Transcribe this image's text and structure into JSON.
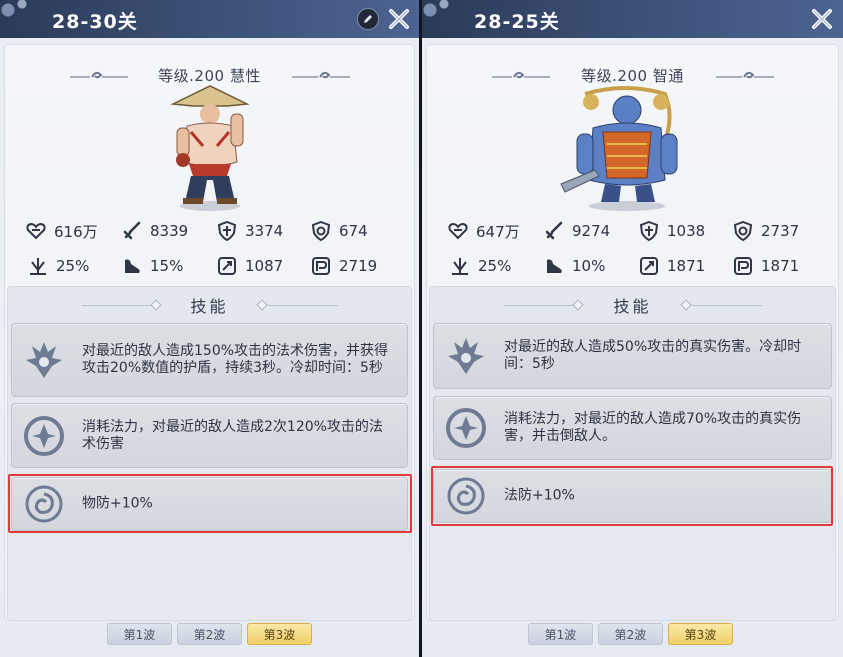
{
  "left": {
    "title": "28-30关",
    "level": "等级.200 慧性",
    "stats": {
      "hp": "616万",
      "atk": "8339",
      "pdef": "3374",
      "mdef": "674",
      "crit": "25%",
      "speed": "15%",
      "ppen": "1087",
      "mpen": "2719"
    },
    "skills_title": "技能",
    "skills": [
      {
        "icon": "spiky-flame-icon",
        "text": "对最近的敌人造成150%攻击的法术伤害，并获得攻击20%数值的护盾，持续3秒。冷却时间：5秒"
      },
      {
        "icon": "swirl-orb-icon",
        "text": "消耗法力，对最近的敌人造成2次120%攻击的法术伤害"
      },
      {
        "icon": "spiral-emblem-icon",
        "text": "物防+10%"
      }
    ],
    "waves": [
      "第1波",
      "第2波",
      "第3波"
    ],
    "active_wave": 2
  },
  "right": {
    "title": "28-25关",
    "level": "等级.200 智通",
    "stats": {
      "hp": "647万",
      "atk": "9274",
      "pdef": "1038",
      "mdef": "2737",
      "crit": "25%",
      "speed": "10%",
      "ppen": "1871",
      "mpen": "1871"
    },
    "skills_title": "技能",
    "skills": [
      {
        "icon": "spiky-flame-icon",
        "text": "对最近的敌人造成50%攻击的真实伤害。冷却时间：5秒"
      },
      {
        "icon": "swirl-orb-icon",
        "text": "消耗法力，对最近的敌人造成70%攻击的真实伤害，并击倒敌人。"
      },
      {
        "icon": "spiral-emblem-icon",
        "text": "法防+10%"
      }
    ],
    "waves": [
      "第1波",
      "第2波",
      "第3波"
    ],
    "active_wave": 2
  },
  "colors": {
    "header": "#3b4f74",
    "highlight": "#e23a3a",
    "active_wave": "#f1cf6a",
    "icon": "#5f6b82"
  }
}
